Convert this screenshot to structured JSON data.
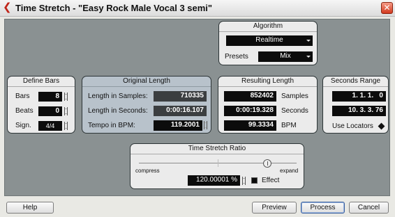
{
  "window": {
    "title": "Time Stretch - \"Easy Rock Male Vocal 3 semi\""
  },
  "algorithm": {
    "header": "Algorithm",
    "mode_value": "Realtime",
    "presets_label": "Presets",
    "presets_value": "Mix"
  },
  "define_bars": {
    "header": "Define Bars",
    "bars_label": "Bars",
    "bars_value": "8",
    "beats_label": "Beats",
    "beats_value": "0",
    "sign_label": "Sign.",
    "sign_value": "4/4"
  },
  "original_length": {
    "header": "Original Length",
    "samples_label": "Length in Samples:",
    "samples_value": "710335",
    "seconds_label": "Length in Seconds:",
    "seconds_value": "0:00:16.107",
    "tempo_label": "Tempo in BPM:",
    "tempo_value": "119.2001"
  },
  "resulting_length": {
    "header": "Resulting Length",
    "samples_value": "852402",
    "samples_label": "Samples",
    "seconds_value": "0:00:19.328",
    "seconds_label": "Seconds",
    "bpm_value": "99.3334",
    "bpm_label": "BPM"
  },
  "seconds_range": {
    "header": "Seconds Range",
    "start_value": "1. 1. 1.   0",
    "end_value": "10. 3. 3. 76",
    "use_locators_label": "Use Locators"
  },
  "ratio": {
    "header": "Time Stretch Ratio",
    "compress_label": "compress",
    "expand_label": "expand",
    "value": "120.00001 %",
    "effect_label": "Effect",
    "slider_fraction": 0.83
  },
  "buttons": {
    "help": "Help",
    "preview": "Preview",
    "process": "Process",
    "cancel": "Cancel"
  }
}
